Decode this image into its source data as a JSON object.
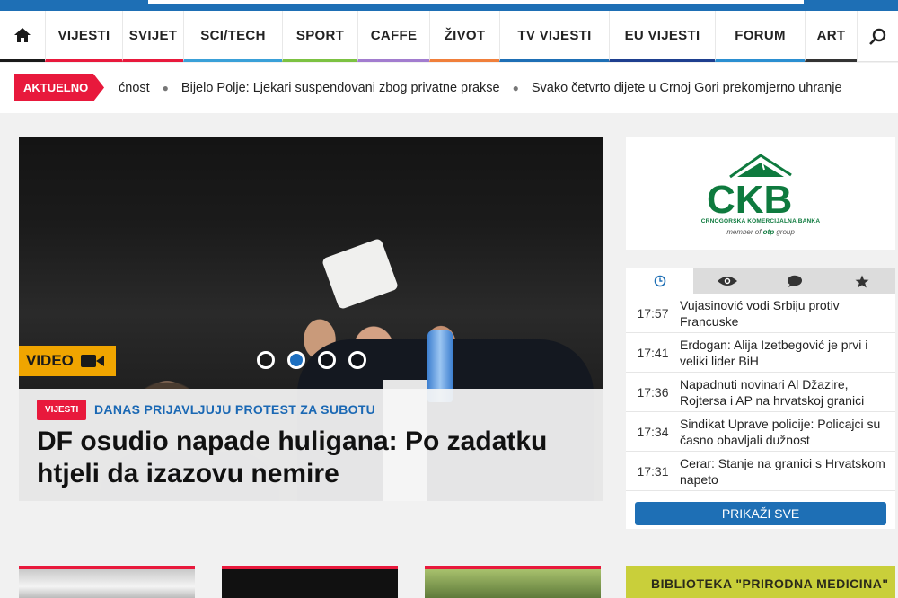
{
  "nav": {
    "items": [
      {
        "label": "VIJESTI",
        "color": "#e8193c"
      },
      {
        "label": "SVIJET",
        "color": "#e8193c"
      },
      {
        "label": "SCI/TECH",
        "color": "#3aa0d8"
      },
      {
        "label": "SPORT",
        "color": "#7cc242"
      },
      {
        "label": "CAFFE",
        "color": "#a27ccf"
      },
      {
        "label": "ŽIVOT",
        "color": "#f07f3b"
      },
      {
        "label": "TV VIJESTI",
        "color": "#1e6fb5"
      },
      {
        "label": "EU VIJESTI",
        "color": "#1e3f8f"
      },
      {
        "label": "FORUM",
        "color": "#2b8fd1"
      },
      {
        "label": "ART",
        "color": "#333333"
      }
    ]
  },
  "ticker": {
    "badge": "AKTUELNO",
    "items": [
      "ćnost",
      "Bijelo Polje: Ljekari suspendovani zbog privatne prakse",
      "Svako četvrto dijete u Crnoj Gori prekomjerno uhranje"
    ]
  },
  "hero": {
    "video_label": "VIDEO",
    "category": "VIJESTI",
    "kicker": "DANAS PRIJAVLJUJU PROTEST ZA SUBOTU",
    "headline": "DF osudio napade huligana: Po zadatku htjeli da izazovu nemire",
    "slides": 4,
    "active_slide": 2
  },
  "ad": {
    "brand": "CKB",
    "line1": "CRNOGORSKA KOMERCIJALNA BANKA",
    "line2_prefix": "member of",
    "line2_brand": "otp",
    "line2_suffix": "group"
  },
  "latest": {
    "tabs": [
      "clock-icon",
      "eye-icon",
      "comment-icon",
      "star-icon"
    ],
    "items": [
      {
        "time": "17:57",
        "title": "Vujasinović vodi Srbiju protiv Francuske"
      },
      {
        "time": "17:41",
        "title": "Erdogan: Alija Izetbegović je prvi i veliki lider BiH"
      },
      {
        "time": "17:36",
        "title": "Napadnuti novinari Al Džazire, Rojtersa i AP na hrvatskoj granici"
      },
      {
        "time": "17:34",
        "title": "Sindikat Uprave policije: Policajci su časno obavljali dužnost"
      },
      {
        "time": "17:31",
        "title": "Cerar: Stanje na granici s Hrvatskom napeto"
      }
    ],
    "show_all": "PRIKAŽI SVE"
  },
  "bottom": {
    "banner_text": "BIBLIOTEKA \"PRIRODNA MEDICINA\""
  }
}
